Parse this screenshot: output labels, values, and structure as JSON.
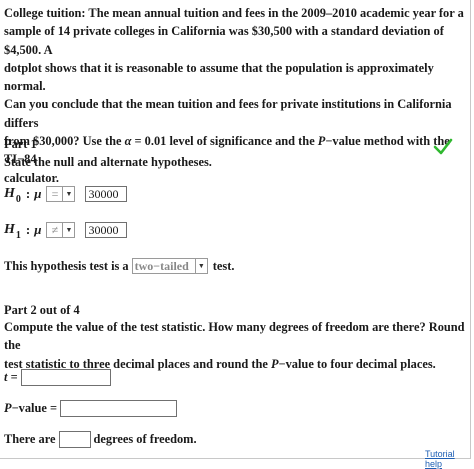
{
  "question": {
    "line1": "College tuition: The mean annual tuition and fees in the 2009–2010 academic year for a",
    "line2": "sample of 14 private colleges in California was $30,500 with a standard deviation of $4,500. A",
    "line3": "dotplot shows that it is reasonable to assume that the population is approximately normal.",
    "line4": "Can you conclude that the mean tuition and fees for private institutions in California differs",
    "line5a": "from $30,000? Use the ",
    "alpha": "α",
    "line5b": " = 0.01 level of significance and the ",
    "p": "P",
    "line5c": "−value method with the TI−84",
    "line6": "calculator."
  },
  "part1": {
    "title": "Part 1",
    "instruction": "State the null and alternate hypotheses.",
    "h0": {
      "symbol": "H",
      "sub": "0",
      "colon": ":",
      "mu": "μ",
      "op": "=",
      "value": "30000"
    },
    "h1": {
      "symbol": "H",
      "sub": "1",
      "colon": ":",
      "mu": "μ",
      "op": "≠",
      "value": "30000"
    },
    "test_prefix": "This hypothesis test is a",
    "test_type": "two−tailed",
    "test_suffix": "test.",
    "status_color": "#2fb82f"
  },
  "part2": {
    "title": "Part 2 out of 4",
    "line1": "Compute the value of the test statistic. How many degrees of freedom are there? Round the",
    "line2a": "test statistic to three decimal places and round the ",
    "p": "P",
    "line2b": "−value to four decimal places.",
    "t_var": "t",
    "t_eq": "=",
    "pval_p": "P",
    "pval_rest": "−value =",
    "df_prefix": "There are",
    "df_suffix": "degrees of freedom."
  },
  "footer": {
    "help_link": "Tutorial help"
  }
}
